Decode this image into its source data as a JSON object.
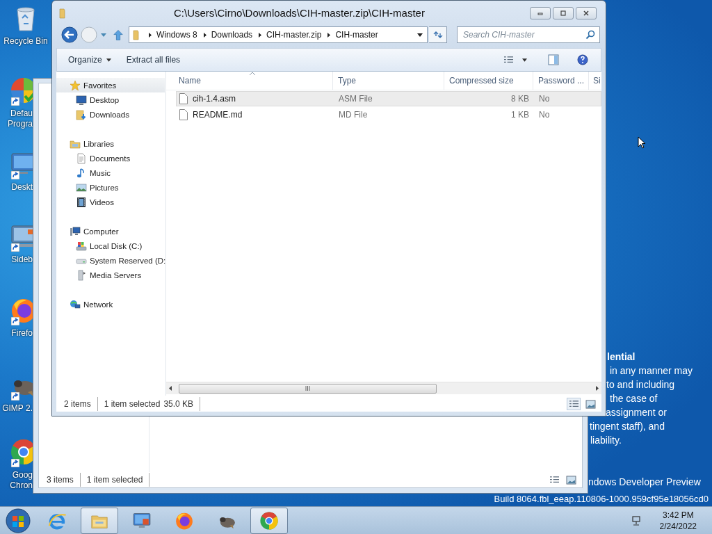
{
  "desktop_icons": [
    {
      "kind": "recycle-bin",
      "label": "Recycle Bin",
      "shortcut": false
    },
    {
      "kind": "default-programs",
      "label": "Defau\nProgra",
      "shortcut": true
    },
    {
      "kind": "display",
      "label": "Deskt",
      "shortcut": true
    },
    {
      "kind": "sidebar",
      "label": "Sideb",
      "shortcut": true
    },
    {
      "kind": "firefox",
      "label": "Firefo",
      "shortcut": true
    },
    {
      "kind": "gimp",
      "label": "GIMP 2.",
      "shortcut": true
    },
    {
      "kind": "chrome",
      "label": "Goog\nChron",
      "shortcut": true
    }
  ],
  "desktop_text": [
    {
      "text": "lential",
      "bold": true
    },
    {
      "text": "in any manner may",
      "bold": false
    },
    {
      "text": "to and including",
      "bold": false
    },
    {
      "text": "the case of",
      "bold": false
    },
    {
      "text": "assignment or",
      "bold": false
    },
    {
      "text": "tingent staff), and",
      "bold": false
    },
    {
      "text": "liability.",
      "bold": false
    },
    {
      "text": "ndows Developer Preview",
      "bold": false
    },
    {
      "text": "Build 8064.fbl_eeap.110806-1000.959cf95e18056cd0",
      "bold": false
    }
  ],
  "back_window": {
    "status": [
      "3 items",
      "1 item selected"
    ]
  },
  "window": {
    "title": "C:\\Users\\Cirno\\Downloads\\CIH-master.zip\\CIH-master",
    "breadcrumb": [
      "Windows 8",
      "Downloads",
      "CIH-master.zip",
      "CIH-master"
    ],
    "search": {
      "placeholder": "Search CIH-master"
    },
    "commands": [
      {
        "label": "Organize",
        "menu": true
      },
      {
        "label": "Extract all files",
        "menu": false
      }
    ],
    "nav": [
      {
        "label": "Favorites",
        "kind": "star",
        "selected": true,
        "children": [
          {
            "label": "Desktop",
            "kind": "desktop",
            "selected": false
          },
          {
            "label": "Downloads",
            "kind": "downloads",
            "selected": false
          }
        ]
      },
      {
        "label": "Libraries",
        "kind": "libraries",
        "selected": false,
        "children": [
          {
            "label": "Documents",
            "kind": "documents",
            "selected": false
          },
          {
            "label": "Music",
            "kind": "music",
            "selected": false
          },
          {
            "label": "Pictures",
            "kind": "pictures",
            "selected": false
          },
          {
            "label": "Videos",
            "kind": "videos",
            "selected": false
          }
        ]
      },
      {
        "label": "Computer",
        "kind": "computer",
        "selected": false,
        "children": [
          {
            "label": "Local Disk (C:)",
            "kind": "disk",
            "selected": false
          },
          {
            "label": "System Reserved (D:",
            "kind": "drive",
            "selected": false
          },
          {
            "label": "Media Servers",
            "kind": "media-server",
            "selected": false
          }
        ]
      },
      {
        "label": "Network",
        "kind": "network",
        "selected": false
      }
    ],
    "columns": [
      {
        "label": "Name",
        "sorted": true
      },
      {
        "label": "Type",
        "sorted": false
      },
      {
        "label": "Compressed size",
        "sorted": false
      },
      {
        "label": "Password ...",
        "sorted": false
      },
      {
        "label": "Si",
        "sorted": false
      }
    ],
    "rows": [
      {
        "cells": [
          "cih-1.4.asm",
          "ASM File",
          "8 KB",
          "No"
        ],
        "selected": true
      },
      {
        "cells": [
          "README.md",
          "MD File",
          "1 KB",
          "No"
        ],
        "selected": false
      }
    ],
    "status": {
      "count": "2 items",
      "selection": "1 item selected",
      "size": "35.0 KB"
    },
    "views": [
      {
        "kind": "details",
        "selected": true
      },
      {
        "kind": "large-icons",
        "selected": false
      }
    ]
  },
  "taskbar": {
    "apps": [
      {
        "kind": "ie",
        "running": false
      },
      {
        "kind": "explorer",
        "running": true
      },
      {
        "kind": "remote-desktop",
        "running": false
      },
      {
        "kind": "firefox",
        "running": false
      },
      {
        "kind": "gimp",
        "running": false
      },
      {
        "kind": "chrome",
        "running": true
      }
    ],
    "clock": {
      "time": "3:42 PM",
      "date": "2/24/2022"
    }
  }
}
